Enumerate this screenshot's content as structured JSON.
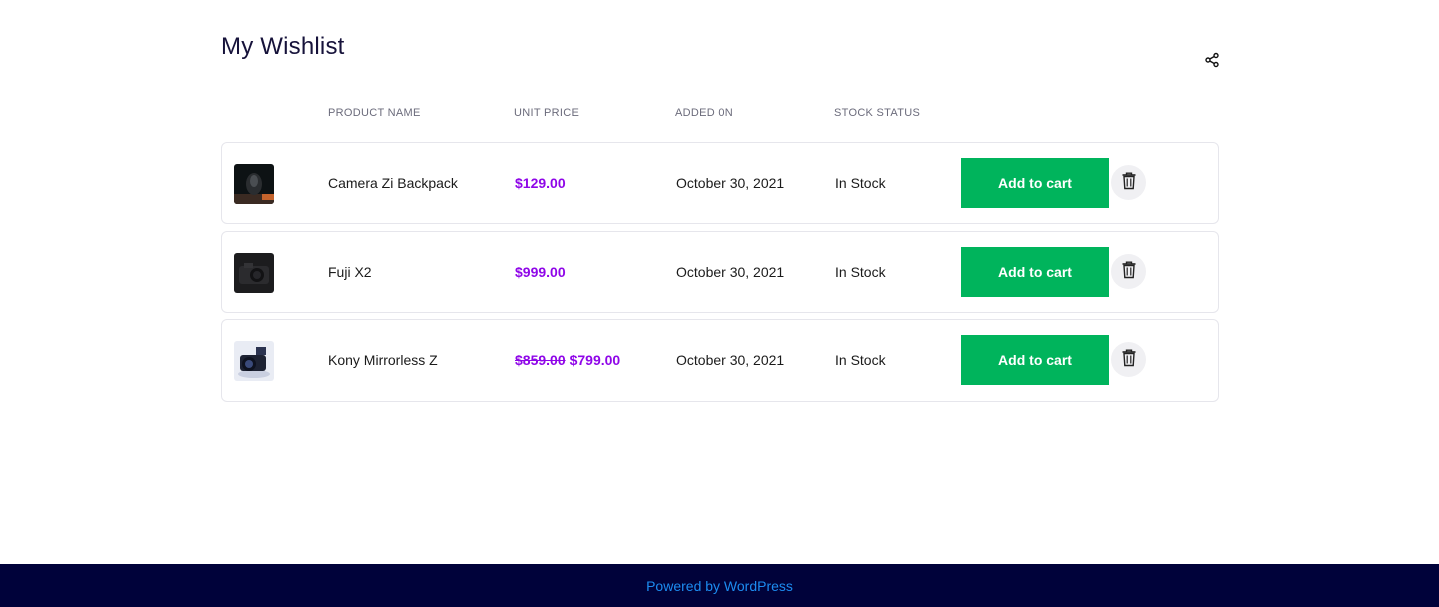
{
  "page": {
    "title": "My Wishlist"
  },
  "table": {
    "headers": {
      "product_name": "PRODUCT NAME",
      "unit_price": "UNIT PRICE",
      "added_on": "ADDED 0N",
      "stock_status": "STOCK STATUS"
    },
    "rows": [
      {
        "name": "Camera Zi Backpack",
        "price": "$129.00",
        "old_price": "",
        "added": "October 30, 2021",
        "stock": "In Stock",
        "cart_label": "Add to cart"
      },
      {
        "name": "Fuji X2",
        "price": "$999.00",
        "old_price": "",
        "added": "October 30, 2021",
        "stock": "In Stock",
        "cart_label": "Add to cart"
      },
      {
        "name": "Kony Mirrorless Z",
        "price": "$799.00",
        "old_price": "$859.00",
        "added": "October 30, 2021",
        "stock": "In Stock",
        "cart_label": "Add to cart"
      }
    ]
  },
  "footer": {
    "text": "Powered by WordPress"
  },
  "colors": {
    "price": "#8f06e8",
    "cart_button": "#00b45c",
    "footer_bg": "#00023a",
    "footer_link": "#1c8cf0"
  },
  "icons": {
    "share": "share-icon",
    "delete": "trash-icon"
  }
}
